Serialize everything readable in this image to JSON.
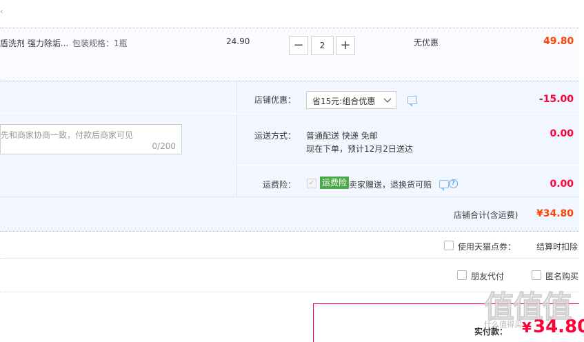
{
  "item": {
    "name": "盾洗剂 强力除垢...",
    "spec": "包装规格：1瓶",
    "price": "24.90",
    "qty_minus": "−",
    "quantity": "2",
    "qty_plus": "+",
    "discount": "无优惠",
    "subtotal": "49.80"
  },
  "message": {
    "placeholder": "先和商家协商一致，付款后商家可见",
    "counter": "0/200"
  },
  "shop_discount": {
    "label": "店铺优惠：",
    "selected": "省15元:组合优惠",
    "amount": "-15.00"
  },
  "shipping": {
    "label": "运送方式：",
    "method": "普通配送 快递 免邮",
    "note": "现在下单，预计12月2日送达",
    "amount": "0.00"
  },
  "freight_insurance": {
    "label": "运费险：",
    "tag": "运费险",
    "desc": "卖家赠送，退换货可赔",
    "amount": "0.00"
  },
  "shop_total": {
    "label": "店铺合计(含运费)",
    "amount": "¥34.80"
  },
  "points": {
    "label": "使用天猫点券：",
    "note": "结算时扣除"
  },
  "pay_options": {
    "friend_pay": "朋友代付",
    "anonymous": "匿名购买"
  },
  "final": {
    "label": "实付款：",
    "yen": "¥",
    "amount": "34.80"
  },
  "watermark": {
    "logo": "值值值",
    "site": "什么值得买"
  },
  "colors": {
    "accent_red": "#ff0036",
    "price_orange": "#ff4200",
    "panel_bg": "#f2f7ff",
    "tag_green": "#4ba94b"
  },
  "icons": [
    "chevron-down-icon",
    "chat-icon",
    "help-icon",
    "check-icon"
  ]
}
